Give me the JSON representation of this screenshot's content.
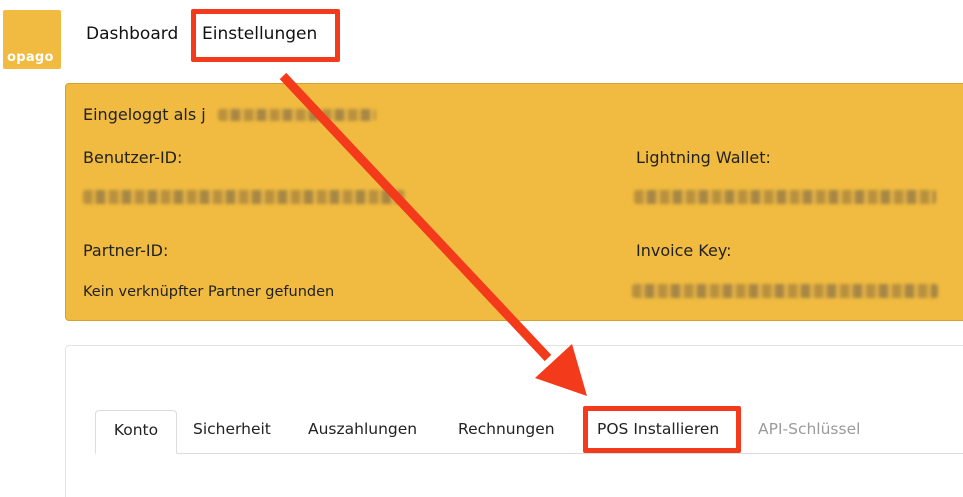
{
  "logo": {
    "text": "opago"
  },
  "nav": {
    "dashboard": "Dashboard",
    "settings": "Einstellungen"
  },
  "account": {
    "logged_in_prefix": "Eingeloggt als j",
    "user_id_label": "Benutzer-ID:",
    "partner_id_label": "Partner-ID:",
    "partner_none": "Kein verknüpfter Partner gefunden",
    "wallet_label": "Lightning Wallet:",
    "invoice_key_label": "Invoice Key:"
  },
  "tabs": [
    {
      "label": "Konto",
      "active": true
    },
    {
      "label": "Sicherheit"
    },
    {
      "label": "Auszahlungen"
    },
    {
      "label": "Rechnungen"
    },
    {
      "label": "POS Installieren"
    },
    {
      "label": "API-Schlüssel",
      "disabled": true
    }
  ],
  "colors": {
    "brand_yellow": "#f0bb40",
    "annotation_red": "#f33a1a",
    "disabled_tab": "#9b9b9b"
  }
}
